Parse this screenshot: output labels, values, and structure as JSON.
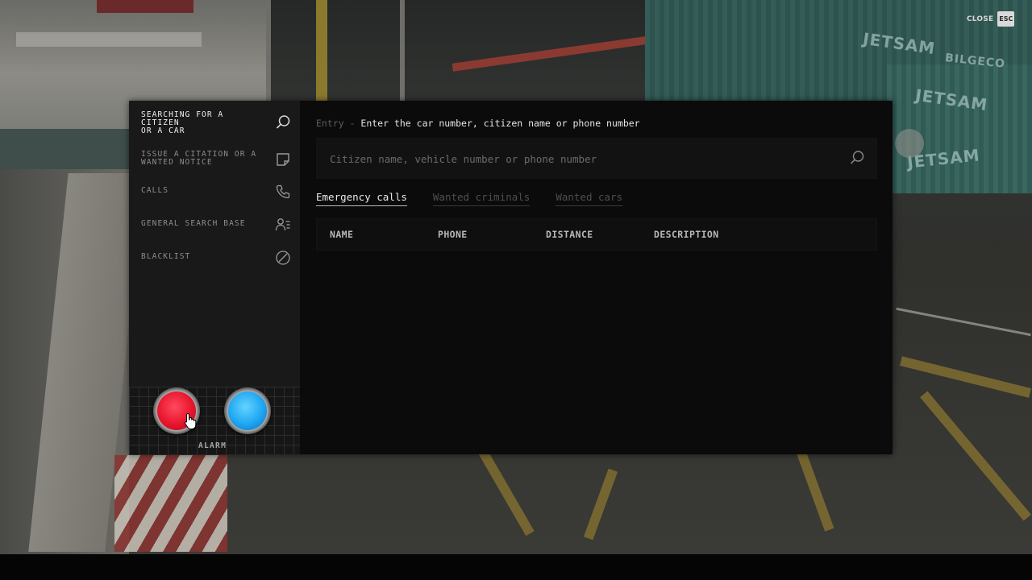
{
  "close": {
    "label": "CLOSE",
    "key": "ESC"
  },
  "background": {
    "logos": [
      "JETSAM",
      "JETSAM",
      "JETSAM",
      "BILGECO"
    ]
  },
  "sidebar": {
    "items": [
      {
        "label": "SEARCHING FOR A\nCITIZEN\nOR A CAR",
        "icon": "search-icon",
        "active": true
      },
      {
        "label": "ISSUE A CITATION OR A\nWANTED NOTICE",
        "icon": "note-icon",
        "active": false
      },
      {
        "label": "CALLS",
        "icon": "phone-icon",
        "active": false
      },
      {
        "label": "GENERAL SEARCH BASE",
        "icon": "user-list-icon",
        "active": false
      },
      {
        "label": "BLACKLIST",
        "icon": "blocked-icon",
        "active": false
      }
    ],
    "alarm": {
      "label": "ALARM",
      "buttons": [
        {
          "name": "red",
          "color": "#e8152d"
        },
        {
          "name": "blue",
          "color": "#1fa6f2"
        }
      ]
    }
  },
  "main": {
    "entry_prefix": "Entry -",
    "entry_text": "Enter the car number, citizen name or phone number",
    "search": {
      "placeholder": "Citizen name, vehicle number or phone number",
      "value": ""
    },
    "tabs": [
      {
        "label": "Emergency calls",
        "active": true
      },
      {
        "label": "Wanted criminals",
        "active": false
      },
      {
        "label": "Wanted cars",
        "active": false
      }
    ],
    "table": {
      "columns": [
        "NAME",
        "PHONE",
        "DISTANCE",
        "DESCRIPTION"
      ],
      "rows": []
    }
  }
}
